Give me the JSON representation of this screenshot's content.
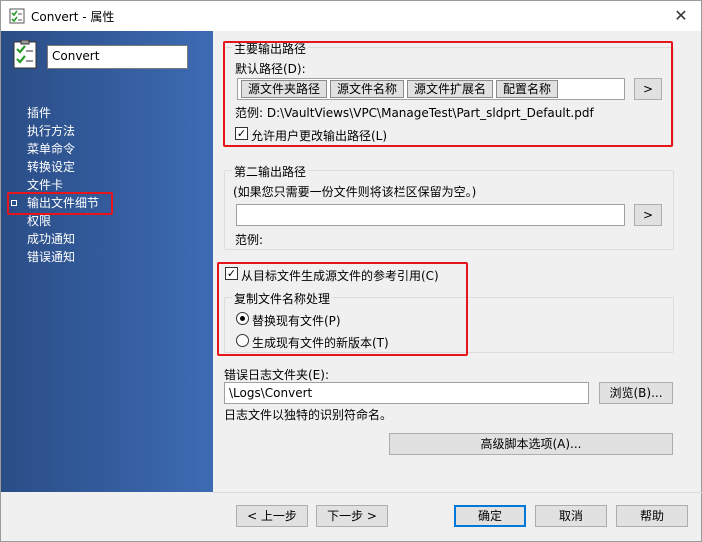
{
  "window": {
    "title": "Convert - 属性",
    "close_glyph": "✕"
  },
  "sidebar": {
    "name_value": "Convert",
    "items": [
      {
        "label": "插件"
      },
      {
        "label": "执行方法"
      },
      {
        "label": "菜单命令"
      },
      {
        "label": "转换设定"
      },
      {
        "label": "文件卡"
      },
      {
        "label": "输出文件细节",
        "selected": true
      },
      {
        "label": "权限"
      },
      {
        "label": "成功通知"
      },
      {
        "label": "错误通知"
      }
    ]
  },
  "primary_output": {
    "group_label": "主要输出路径",
    "default_path_label": "默认路径(D):",
    "chips": [
      "源文件夹路径",
      "源文件名称",
      "源文件扩展名",
      "配置名称"
    ],
    "browse_label": ">",
    "example_text": "范例: D:\\VaultViews\\VPC\\ManageTest\\Part_sldprt_Default.pdf",
    "allow_change_label": "允许用户更改输出路径(L)",
    "allow_change_checked": true
  },
  "secondary_output": {
    "group_label": "第二输出路径",
    "hint": "(如果您只需要一份文件则将该栏区保留为空。)",
    "path_value": "",
    "browse_label": ">",
    "example_label": "范例:"
  },
  "reference": {
    "checkbox_label": "从目标文件生成源文件的参考引用(C)",
    "checked": true,
    "group_label": "复制文件名称处理",
    "options": [
      {
        "label": "替换现有文件(P)",
        "selected": true
      },
      {
        "label": "生成现有文件的新版本(T)",
        "selected": false
      }
    ]
  },
  "error_log": {
    "label": "错误日志文件夹(E):",
    "value": "\\Logs\\Convert",
    "browse_label": "浏览(B)...",
    "note": "日志文件以独特的识别符命名。"
  },
  "advanced_button": "高级脚本选项(A)...",
  "footer": {
    "back": "< 上一步",
    "next": "下一步 >",
    "ok": "确定",
    "cancel": "取消",
    "help": "帮助"
  },
  "colors": {
    "sidebar": "#2a4d86",
    "highlight_box": "#e8141c",
    "default_button_border": "#0078d7"
  }
}
